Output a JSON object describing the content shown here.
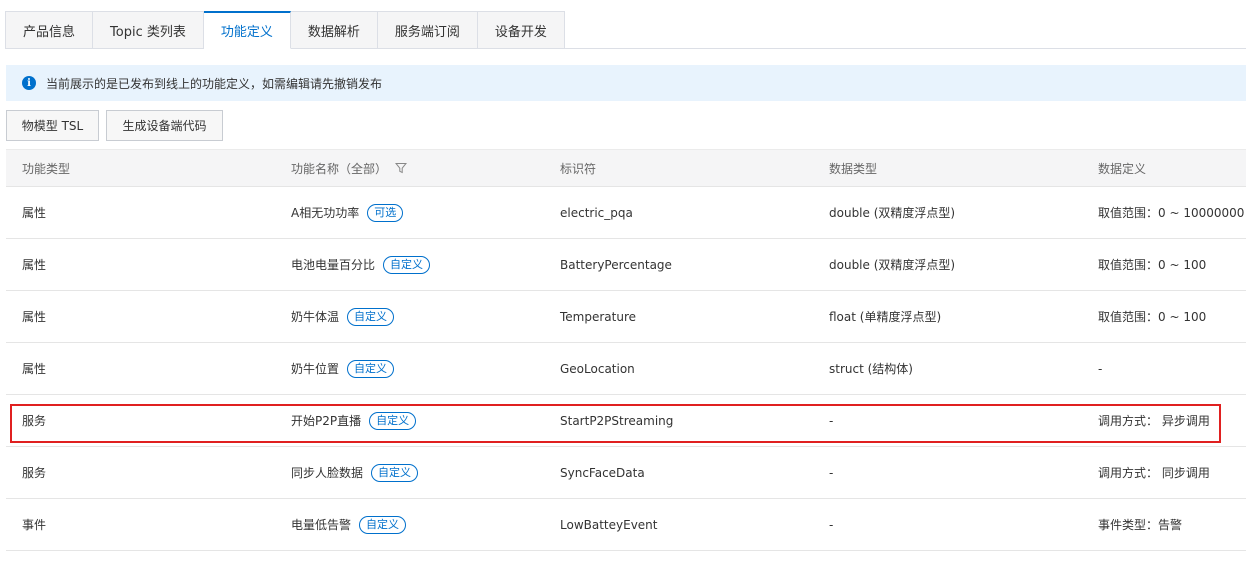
{
  "tabs": [
    "产品信息",
    "Topic 类列表",
    "功能定义",
    "数据解析",
    "服务端订阅",
    "设备开发"
  ],
  "active_tab_index": 2,
  "notice": {
    "icon": "info-icon",
    "text": "当前展示的是已发布到线上的功能定义，如需编辑请先撤销发布"
  },
  "toolbar": {
    "tsl_label": "物模型 TSL",
    "code_label": "生成设备端代码"
  },
  "table": {
    "headers": {
      "type": "功能类型",
      "name": "功能名称（全部）",
      "identifier": "标识符",
      "data_type": "数据类型",
      "definition": "数据定义"
    },
    "rows": [
      {
        "type": "属性",
        "name": "A相无功功率",
        "tag": "可选",
        "identifier": "electric_pqa",
        "data_type": "double (双精度浮点型)",
        "definition": "取值范围：0 ~ 10000000"
      },
      {
        "type": "属性",
        "name": "电池电量百分比",
        "tag": "自定义",
        "identifier": "BatteryPercentage",
        "data_type": "double (双精度浮点型)",
        "definition": "取值范围：0 ~ 100"
      },
      {
        "type": "属性",
        "name": "奶牛体温",
        "tag": "自定义",
        "identifier": "Temperature",
        "data_type": "float (单精度浮点型)",
        "definition": "取值范围：0 ~ 100"
      },
      {
        "type": "属性",
        "name": "奶牛位置",
        "tag": "自定义",
        "identifier": "GeoLocation",
        "data_type": "struct (结构体)",
        "definition": "-"
      },
      {
        "type": "服务",
        "name": "开始P2P直播",
        "tag": "自定义",
        "identifier": "StartP2PStreaming",
        "data_type": "-",
        "definition": "调用方式：  异步调用"
      },
      {
        "type": "服务",
        "name": "同步人脸数据",
        "tag": "自定义",
        "identifier": "SyncFaceData",
        "data_type": "-",
        "definition": "调用方式：  同步调用"
      },
      {
        "type": "事件",
        "name": "电量低告警",
        "tag": "自定义",
        "identifier": "LowBatteyEvent",
        "data_type": "-",
        "definition": "事件类型：告警"
      }
    ]
  },
  "highlighted_row_index": 4,
  "colors": {
    "accent": "#0070cc",
    "highlight": "#e02020",
    "notice_bg": "#e8f3fd"
  }
}
